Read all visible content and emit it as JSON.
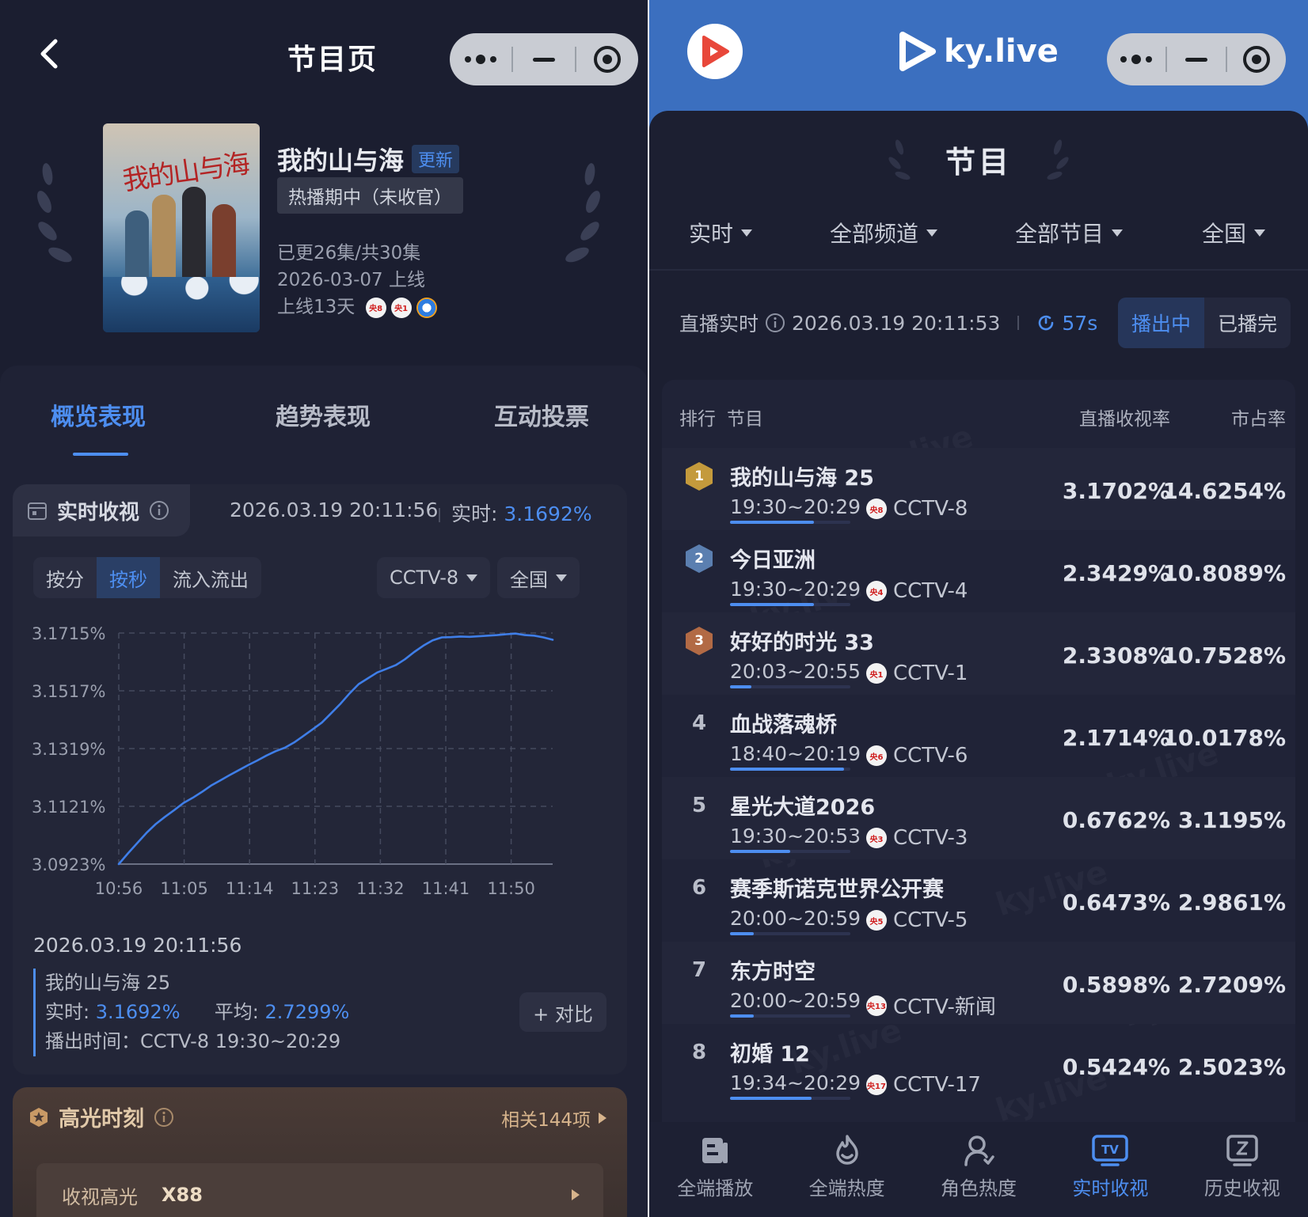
{
  "left": {
    "nav": {
      "title": "节目页"
    },
    "show": {
      "title": "我的山与海",
      "badge": "更新",
      "poster_text": "我的山与海",
      "status": "热播期中（未收官）",
      "episodes": "已更26集/共30集",
      "premiere": "2026-03-07 上线",
      "days": "上线13天",
      "channels": [
        "央8",
        "央1"
      ]
    },
    "tabs": [
      "概览表现",
      "趋势表现",
      "互动投票"
    ],
    "realtime": {
      "title": "实时收视",
      "time": "2026.03.19 20:11:56",
      "now_label": "实时:",
      "now_value": "3.1692%",
      "segments": [
        "按分",
        "按秒",
        "流入流出"
      ],
      "channel_select": "CCTV-8",
      "region_select": "全国"
    },
    "chart_data": {
      "type": "line",
      "title": "",
      "xlabel": "",
      "ylabel": "",
      "x_ticks": [
        "10:56",
        "11:05",
        "11:14",
        "11:23",
        "11:32",
        "11:41",
        "11:50"
      ],
      "y_ticks": [
        "3.1715%",
        "3.1517%",
        "3.1319%",
        "3.1121%",
        "3.0923%"
      ],
      "ylim": [
        3.0923,
        3.1715
      ],
      "series": [
        {
          "values": [
            3.0923,
            3.096,
            3.0995,
            3.103,
            3.106,
            3.1085,
            3.1108,
            3.1132,
            3.115,
            3.117,
            3.1192,
            3.121,
            3.1228,
            3.1245,
            3.1262,
            3.1278,
            3.1295,
            3.131,
            3.1322,
            3.134,
            3.1362,
            3.1385,
            3.1408,
            3.144,
            3.1472,
            3.1508,
            3.154,
            3.156,
            3.158,
            3.1592,
            3.1605,
            3.1625,
            3.165,
            3.1672,
            3.169,
            3.17,
            3.1701,
            3.1703,
            3.1702,
            3.1704,
            3.1706,
            3.1708,
            3.1711,
            3.1713,
            3.1708,
            3.1706,
            3.17,
            3.1692
          ]
        }
      ],
      "grid": true,
      "color": "#3f7ee8"
    },
    "tooltip": {
      "date": "2026.03.19 20:11:56",
      "program": "我的山与海 25",
      "now_label": "实时:",
      "now_value": "3.1692%",
      "avg_label": "平均:",
      "avg_value": "2.7299%",
      "airing": "播出时间：CCTV-8 19:30~20:29"
    },
    "compare_label": "+ 对比",
    "highlight": {
      "title": "高光时刻",
      "related": "相关144项",
      "item_label": "收视高光",
      "item_value": "X88"
    }
  },
  "right": {
    "brand": "ky.live",
    "title": "节目",
    "filters": [
      "实时",
      "全部频道",
      "全部节目",
      "全国"
    ],
    "live_label": "直播实时",
    "live_time": "2026.03.19 20:11:53",
    "countdown": "57s",
    "switch": [
      "播出中",
      "已播完"
    ],
    "headers": {
      "rank": "排行",
      "program": "节目",
      "rating": "直播收视率",
      "share": "市占率"
    },
    "rows": [
      {
        "rank": "1",
        "program": "我的山与海 25",
        "slot": "19:30~20:29",
        "channel_badge": "央8",
        "channel": "CCTV-8",
        "rating": "3.1702%",
        "share": "14.6254%",
        "progress": 0.7
      },
      {
        "rank": "2",
        "program": "今日亚洲",
        "slot": "19:30~20:29",
        "channel_badge": "央4",
        "channel": "CCTV-4",
        "rating": "2.3429%",
        "share": "10.8089%",
        "progress": 0.7
      },
      {
        "rank": "3",
        "program": "好好的时光 33",
        "slot": "20:03~20:55",
        "channel_badge": "央1",
        "channel": "CCTV-1",
        "rating": "2.3308%",
        "share": "10.7528%",
        "progress": 0.18
      },
      {
        "rank": "4",
        "program": "血战落魂桥",
        "slot": "18:40~20:19",
        "channel_badge": "央6",
        "channel": "CCTV-6",
        "rating": "2.1714%",
        "share": "10.0178%",
        "progress": 0.95
      },
      {
        "rank": "5",
        "program": "星光大道2026",
        "slot": "19:30~20:53",
        "channel_badge": "央3",
        "channel": "CCTV-3",
        "rating": "0.6762%",
        "share": "3.1195%",
        "progress": 0.5
      },
      {
        "rank": "6",
        "program": "赛季斯诺克世界公开赛",
        "slot": "20:00~20:59",
        "channel_badge": "央5",
        "channel": "CCTV-5",
        "rating": "0.6473%",
        "share": "2.9861%",
        "progress": 0.2
      },
      {
        "rank": "7",
        "program": "东方时空",
        "slot": "20:00~20:59",
        "channel_badge": "央13",
        "channel": "CCTV-新闻",
        "rating": "0.5898%",
        "share": "2.7209%",
        "progress": 0.2
      },
      {
        "rank": "8",
        "program": "初婚 12",
        "slot": "19:34~20:29",
        "channel_badge": "央17",
        "channel": "CCTV-17",
        "rating": "0.5424%",
        "share": "2.5023%",
        "progress": 0.68
      }
    ],
    "watermark": "ky.live",
    "tabbar": [
      "全端播放",
      "全端热度",
      "角色热度",
      "实时收视",
      "历史收视"
    ]
  }
}
